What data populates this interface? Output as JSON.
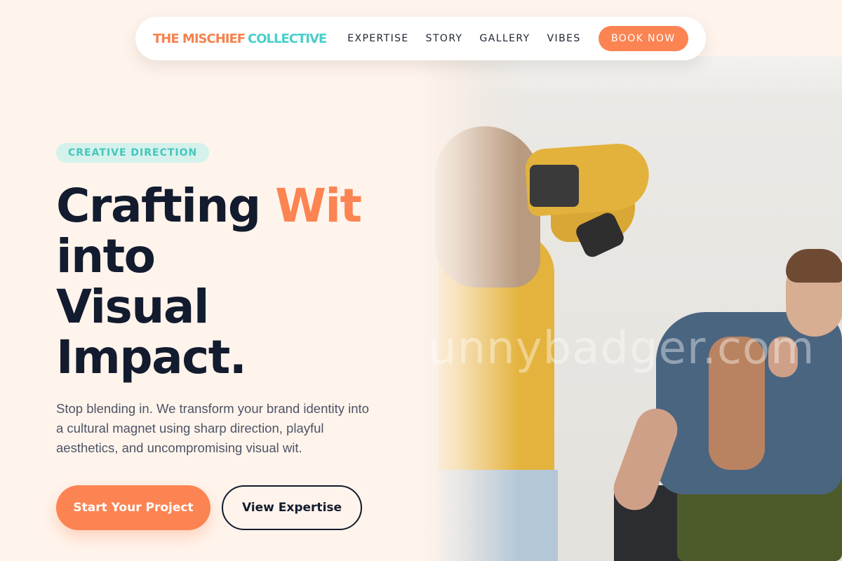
{
  "nav": {
    "brand_part1": "THE MISCHIEF",
    "brand_part2": "COLLECTIVE",
    "links": [
      "EXPERTISE",
      "STORY",
      "GALLERY",
      "VIBES"
    ],
    "cta": "BOOK NOW"
  },
  "hero": {
    "tag": "CREATIVE DIRECTION",
    "headline_word1": "Crafting",
    "headline_accent": "Wit",
    "headline_line2": "into",
    "headline_line3": "Visual",
    "headline_line4": "Impact.",
    "subtext": "Stop blending in. We transform your brand identity into a cultural magnet using sharp direction, playful aesthetics, and uncompromising visual wit.",
    "primary_button": "Start Your Project",
    "secondary_button": "View Expertise"
  },
  "photo": {
    "watermark": "unnybadger.com"
  },
  "colors": {
    "background": "#FFF4EC",
    "accent_orange": "#FB8452",
    "accent_teal": "#48CFC9",
    "text_dark": "#131B2E"
  }
}
